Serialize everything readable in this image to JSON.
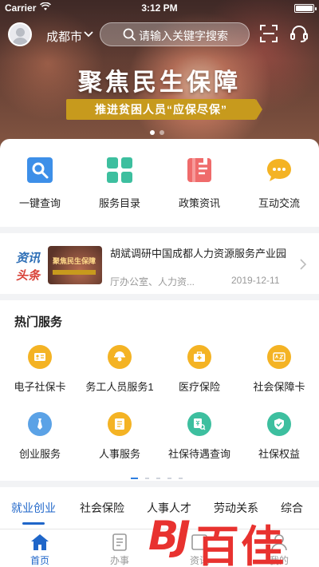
{
  "status_bar": {
    "carrier": "Carrier",
    "time": "3:12 PM"
  },
  "header": {
    "city": "成都市",
    "search_placeholder": "请输入关键字搜索"
  },
  "banner": {
    "title": "聚焦民生保障",
    "subtitle": "推进贫困人员“应保尽保”",
    "slide_count": 2,
    "active_slide": 1
  },
  "quick_entries": [
    {
      "label": "一键查询",
      "icon": "search-icon",
      "color": "#3d8fe8"
    },
    {
      "label": "服务目录",
      "icon": "grid-icon",
      "color": "#3dbf9f"
    },
    {
      "label": "政策资讯",
      "icon": "document-icon",
      "color": "#ef6b6b"
    },
    {
      "label": "互动交流",
      "icon": "chat-icon",
      "color": "#f4b324"
    }
  ],
  "news": {
    "tag_top": "资讯",
    "tag_bottom": "头条",
    "thumb_text": "聚焦民生保障",
    "title": "胡斌调研中国成都人力资源服务产业园",
    "source": "厅办公室、人力资...",
    "date": "2019-12-11"
  },
  "hot_services": {
    "title": "热门服务",
    "items": [
      {
        "label": "电子社保卡",
        "icon": "id-card-icon"
      },
      {
        "label": "务工人员服务1",
        "icon": "worker-icon"
      },
      {
        "label": "医疗保险",
        "icon": "medical-kit-icon"
      },
      {
        "label": "社会保障卡",
        "icon": "card-icon"
      },
      {
        "label": "创业服务",
        "icon": "tie-icon"
      },
      {
        "label": "人事服务",
        "icon": "file-icon"
      },
      {
        "label": "社保待遇查询",
        "icon": "benefit-search-icon"
      },
      {
        "label": "社保权益",
        "icon": "shield-icon"
      }
    ],
    "page_count": 5,
    "active_page": 1
  },
  "tabs": [
    "就业创业",
    "社会保险",
    "人事人才",
    "劳动关系",
    "综合"
  ],
  "active_tab": 0,
  "bottom_nav": [
    {
      "label": "首页",
      "icon": "home-icon"
    },
    {
      "label": "办事",
      "icon": "task-icon"
    },
    {
      "label": "资讯",
      "icon": "news-icon"
    },
    {
      "label": "我的",
      "icon": "user-icon"
    }
  ],
  "active_nav": 0,
  "colors": {
    "primary": "#1f66c9",
    "accent_gold": "#f4b324",
    "watermark": "#e8322f"
  },
  "watermark": {
    "text": "BJ百佳"
  }
}
